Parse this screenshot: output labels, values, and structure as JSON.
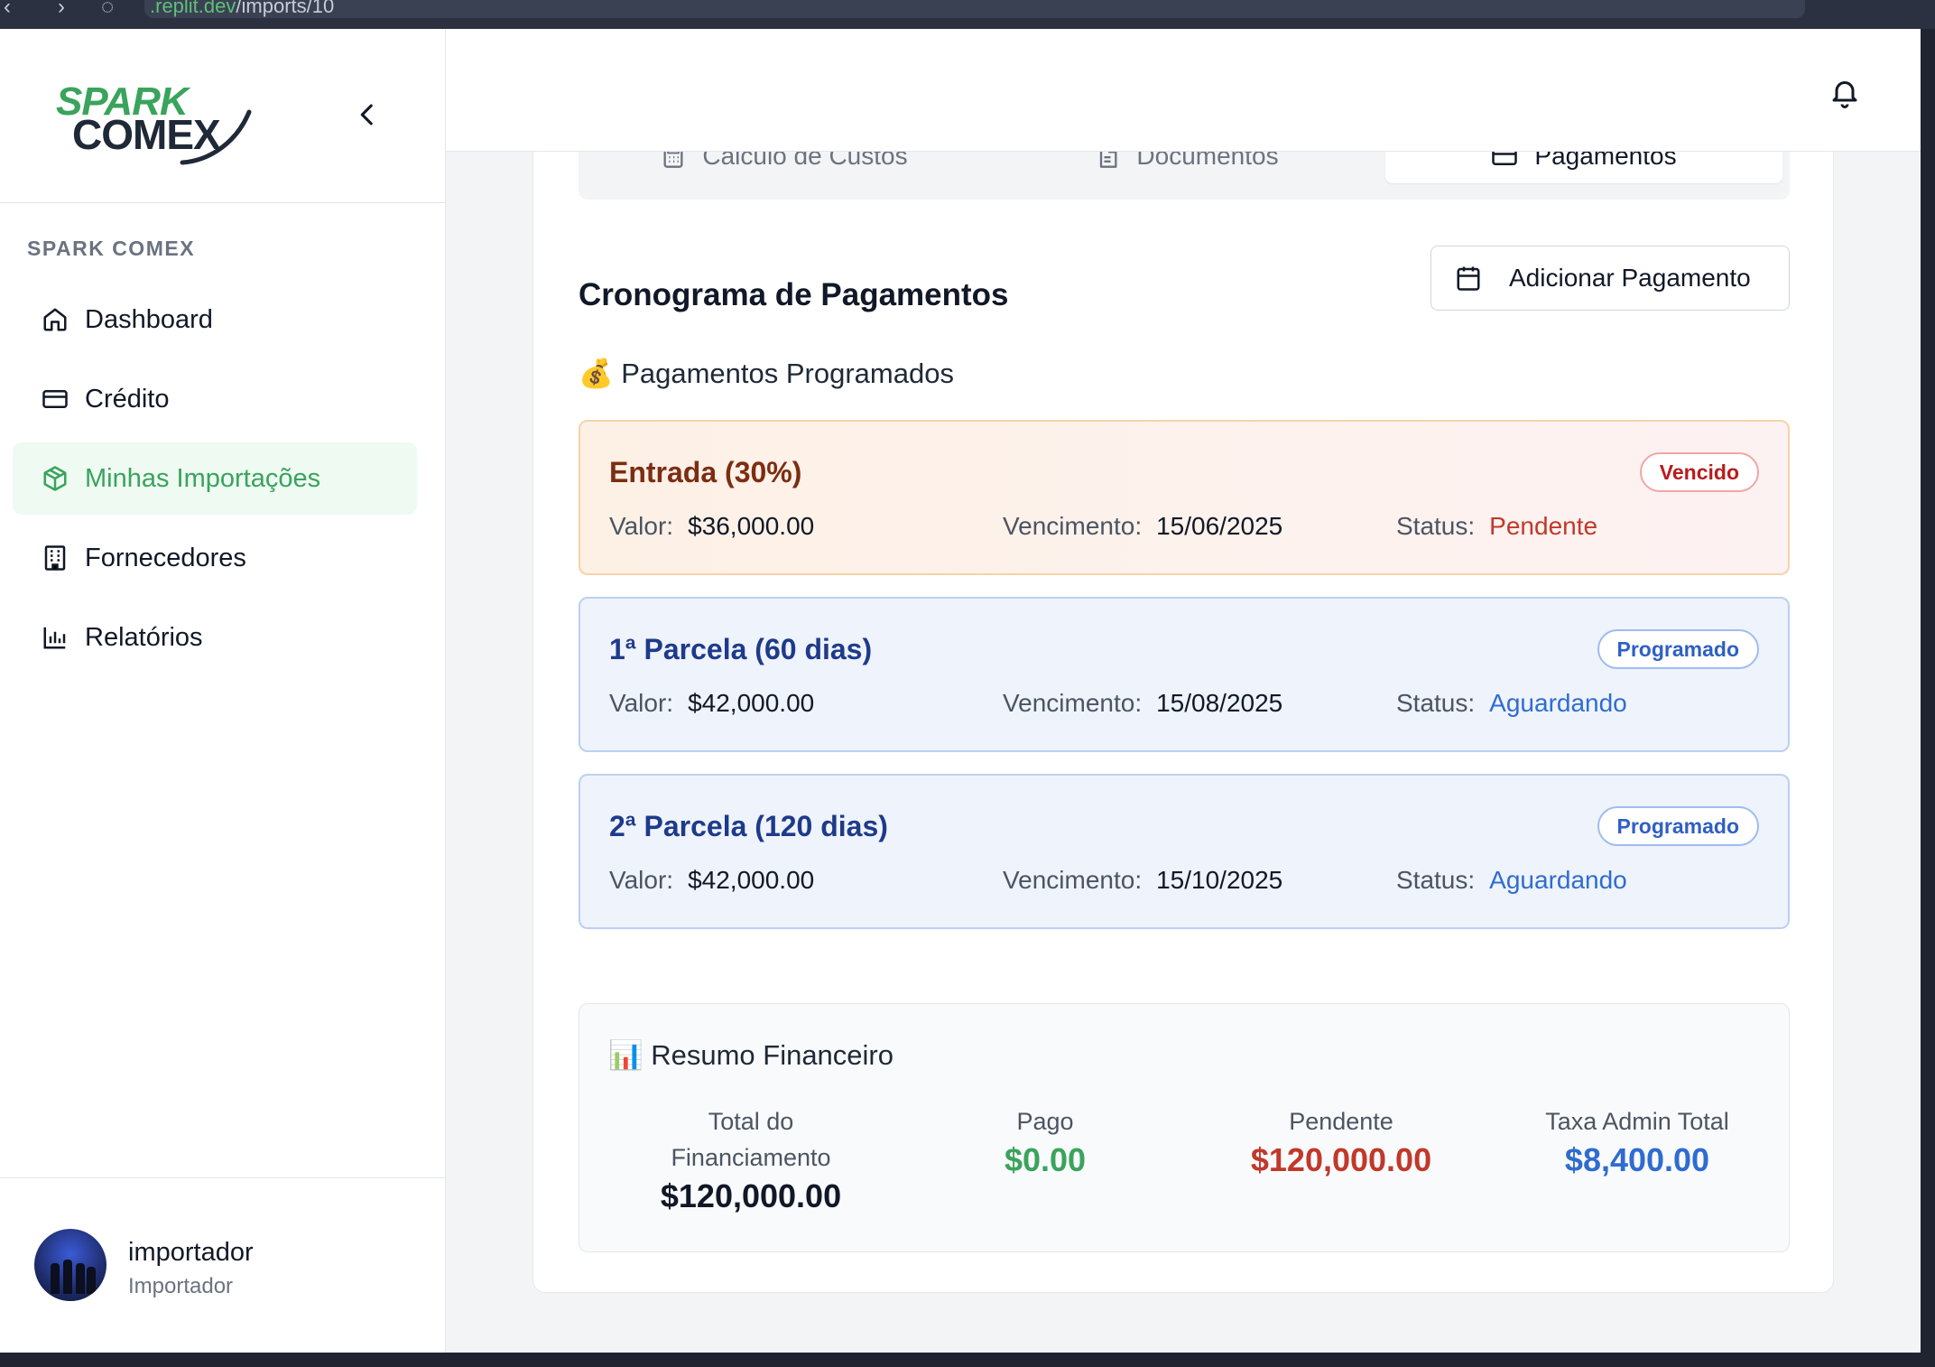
{
  "browser": {
    "url_host": ".replit.dev",
    "url_path": "/imports/10"
  },
  "sidebar": {
    "logo_line1": "SPARK",
    "logo_line2": "COMEX",
    "section_label": "SPARK COMEX",
    "items": [
      {
        "label": "Dashboard",
        "icon": "home-icon"
      },
      {
        "label": "Crédito",
        "icon": "credit-card-icon"
      },
      {
        "label": "Minhas Importações",
        "icon": "package-icon",
        "active": true
      },
      {
        "label": "Fornecedores",
        "icon": "building-icon"
      },
      {
        "label": "Relatórios",
        "icon": "bar-chart-icon"
      }
    ],
    "user": {
      "name": "importador",
      "role": "Importador"
    }
  },
  "tabs": [
    {
      "label": "Cálculo de Custos",
      "icon": "calculator-icon"
    },
    {
      "label": "Documentos",
      "icon": "file-text-icon"
    },
    {
      "label": "Pagamentos",
      "icon": "credit-card-icon",
      "selected": true
    }
  ],
  "main": {
    "title": "Cronograma de Pagamentos",
    "add_button": "Adicionar Pagamento",
    "scheduled_title": "💰 Pagamentos Programados",
    "labels": {
      "value": "Valor:",
      "due": "Vencimento:",
      "status": "Status:"
    },
    "payments": [
      {
        "title": "Entrada (30%)",
        "badge": "Vencido",
        "value": "$36,000.00",
        "due": "15/06/2025",
        "status": "Pendente"
      },
      {
        "title": "1ª Parcela (60 dias)",
        "badge": "Programado",
        "value": "$42,000.00",
        "due": "15/08/2025",
        "status": "Aguardando"
      },
      {
        "title": "2ª Parcela (120 dias)",
        "badge": "Programado",
        "value": "$42,000.00",
        "due": "15/10/2025",
        "status": "Aguardando"
      }
    ],
    "summary": {
      "title": "📊 Resumo Financeiro",
      "total_label": "Total do Financiamento",
      "total_value": "$120,000.00",
      "paid_label": "Pago",
      "paid_value": "$0.00",
      "pending_label": "Pendente",
      "pending_value": "$120,000.00",
      "fee_label": "Taxa Admin Total",
      "fee_value": "$8,400.00"
    }
  },
  "colors": {
    "brand_green": "#3aa35c",
    "overdue_red": "#c0392b",
    "scheduled_blue": "#2f6cd0"
  }
}
